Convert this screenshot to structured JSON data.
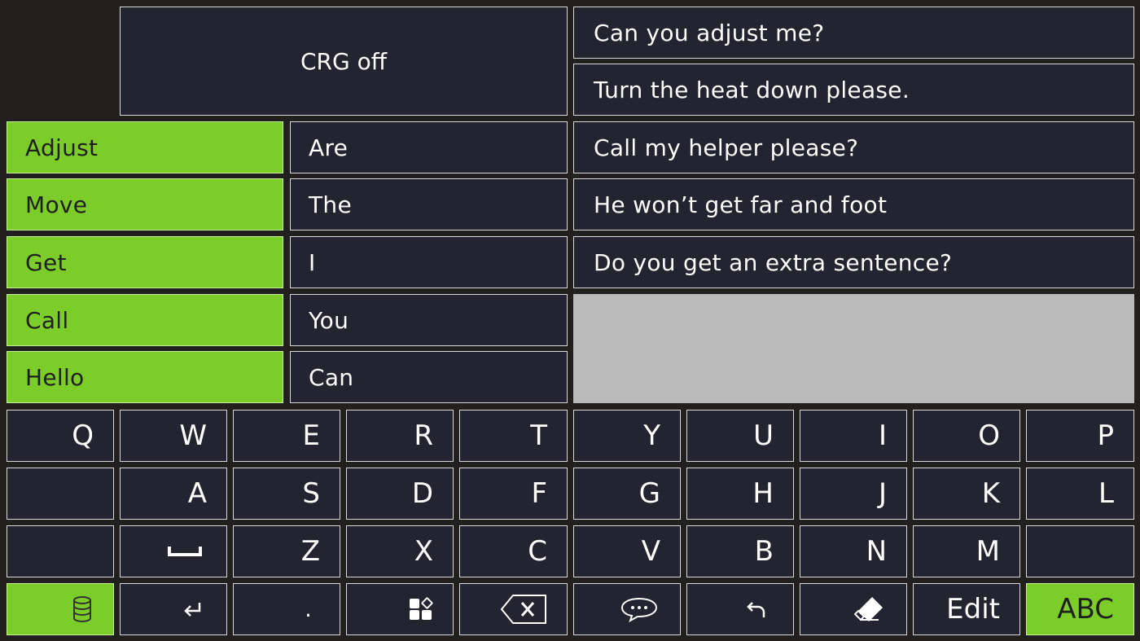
{
  "crg": {
    "label": "CRG off"
  },
  "phrases": [
    "Can you adjust me?",
    "Turn the heat down please.",
    "Call my helper please?",
    "He won’t get far and foot",
    "Do you get an extra sentence?"
  ],
  "verbs": [
    "Adjust",
    "Move",
    "Get",
    "Call",
    "Hello"
  ],
  "words": [
    "Are",
    "The",
    "I",
    "You",
    "Can"
  ],
  "keyboard": {
    "row1": [
      "Q",
      "W",
      "E",
      "R",
      "T",
      "Y",
      "U",
      "I",
      "O",
      "P"
    ],
    "row2": [
      "",
      "A",
      "S",
      "D",
      "F",
      "G",
      "H",
      "J",
      "K",
      "L"
    ],
    "row3": [
      "",
      "",
      "Z",
      "X",
      "C",
      "V",
      "B",
      "N",
      "M",
      ""
    ],
    "period": ".",
    "edit_label": "Edit",
    "abc_label": "ABC"
  },
  "colors": {
    "accent": "#7dcd2a",
    "cell": "#232430",
    "background": "#221f1f",
    "empty": "#bababa"
  },
  "icons": [
    "database-icon",
    "enter-icon",
    "apps-icon",
    "backspace-icon",
    "speech-bubble-icon",
    "undo-icon",
    "eraser-icon",
    "space-icon"
  ]
}
